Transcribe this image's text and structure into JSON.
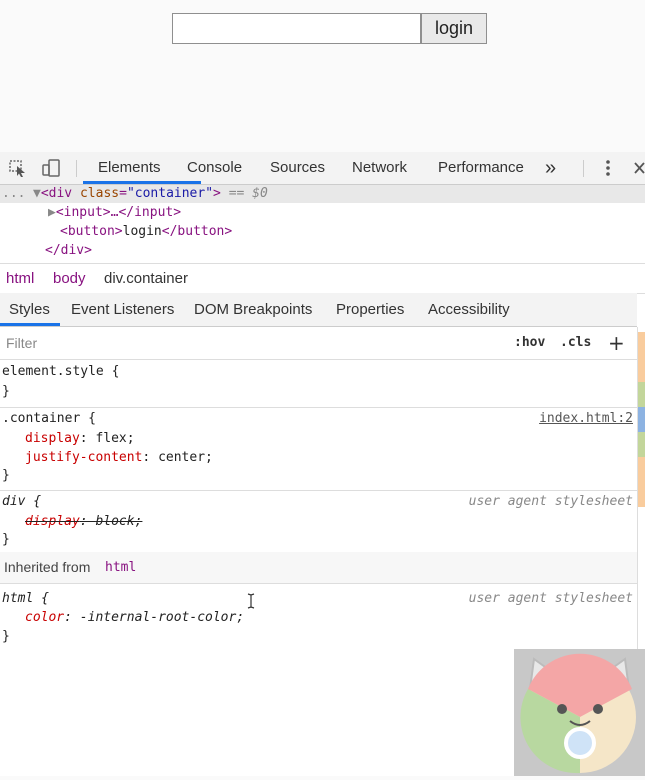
{
  "page": {
    "input_value": "",
    "button_label": "login"
  },
  "devtools": {
    "tabs": [
      "Elements",
      "Console",
      "Sources",
      "Network",
      "Performance"
    ],
    "overflow_label": "»",
    "dom": {
      "line1_ellipsis": "...",
      "line1_tag_open": "<div",
      "line1_attr_name": "class",
      "line1_attr_value": "\"container\"",
      "line1_close": ">",
      "line1_eq": "== $0",
      "line2": "<input>…</input>",
      "line3_open": "<button>",
      "line3_text": "login",
      "line3_close": "</button>",
      "line4": "</div>"
    },
    "breadcrumbs": [
      "html",
      "body",
      "div.container"
    ],
    "subtabs": [
      "Styles",
      "Event Listeners",
      "DOM Breakpoints",
      "Properties",
      "Accessibility"
    ],
    "filter_placeholder": "Filter",
    "hov_label": ":hov",
    "cls_label": ".cls",
    "add_label": "+",
    "rules": {
      "element_style": {
        "selector": "element.style {",
        "close": "}"
      },
      "container": {
        "selector": ".container {",
        "source": "index.html:2",
        "props": [
          {
            "name": "display",
            "value": "flex;"
          },
          {
            "name": "justify-content",
            "value": "center;"
          }
        ],
        "close": "}"
      },
      "div": {
        "selector": "div {",
        "source": "user agent stylesheet",
        "prop_name": "display",
        "prop_value": "block;",
        "close": "}"
      },
      "inherited_label": "Inherited from",
      "inherited_tag": "html",
      "html": {
        "selector": "html {",
        "source": "user agent stylesheet",
        "prop_name": "color",
        "prop_value": "-internal-root-color;",
        "close": "}"
      }
    },
    "strip_colors": [
      "#f9cc9d",
      "#f9cc9d",
      "#f9cc9d",
      "#c3d69b",
      "#8db3e2",
      "#c3d69b",
      "#f9cc9d",
      "#f9cc9d"
    ]
  }
}
